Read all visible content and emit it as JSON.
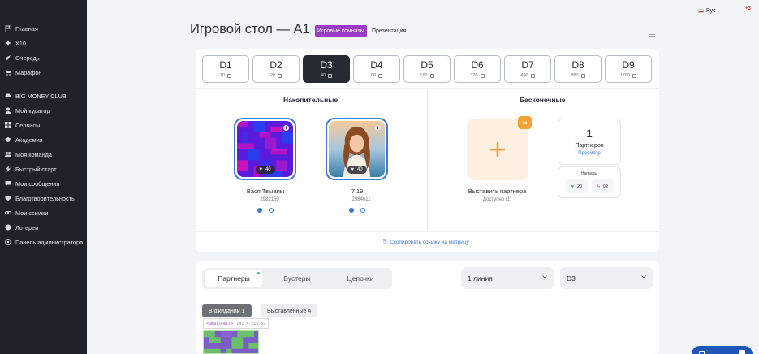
{
  "sidebar": {
    "items": [
      {
        "label": "Главная",
        "icon": "flag-icon"
      },
      {
        "label": "X10",
        "icon": "sparkle-icon"
      },
      {
        "label": "Очередь",
        "icon": "rocket-icon"
      },
      {
        "label": "Марафон",
        "icon": "cart-icon"
      }
    ],
    "items2": [
      {
        "label": "BIG MONEY CLUB",
        "icon": "car-icon"
      },
      {
        "label": "Мой куратор",
        "icon": "user-icon"
      },
      {
        "label": "Сервисы",
        "icon": "grid-icon"
      },
      {
        "label": "Академия",
        "icon": "graduation-cap-icon"
      },
      {
        "label": "Моя команда",
        "icon": "team-icon"
      },
      {
        "label": "Быстрый старт",
        "icon": "lightning-icon"
      },
      {
        "label": "Мои сообщения",
        "icon": "chat-icon"
      },
      {
        "label": "Благотворительность",
        "icon": "heart-icon"
      },
      {
        "label": "Мои ссылки",
        "icon": "link-icon"
      },
      {
        "label": "Лотереи",
        "icon": "ticket-icon"
      },
      {
        "label": "Панель администратора",
        "icon": "settings-icon"
      }
    ]
  },
  "topbar": {
    "lang": "Рус",
    "badge": "+3"
  },
  "page": {
    "title": "Игровой стол — A1",
    "tag_rooms": "Игровые комнаты",
    "tag_presentation": "Презентация"
  },
  "levels": [
    {
      "name": "D1",
      "value": "10"
    },
    {
      "name": "D2",
      "value": "20"
    },
    {
      "name": "D3",
      "value": "40",
      "active": true
    },
    {
      "name": "D4",
      "value": "80"
    },
    {
      "name": "D5",
      "value": "160"
    },
    {
      "name": "D6",
      "value": "320"
    },
    {
      "name": "D7",
      "value": "490"
    },
    {
      "name": "D8",
      "value": "880"
    },
    {
      "name": "D9",
      "value": "1760"
    }
  ],
  "accumulative": {
    "title": "Накопительные",
    "players": [
      {
        "name": "Вася Твыапы",
        "id": "2982159",
        "score": "40"
      },
      {
        "name": "7 19",
        "id": "2984611",
        "score": "40"
      }
    ]
  },
  "infinite": {
    "title": "Бесконечные",
    "add_title": "Выставить партнера",
    "add_sub": "Доступно (1)",
    "partners_count": "1",
    "partners_label": "Партнеров",
    "partners_link": "Просмотр",
    "rewards_label": "Награды",
    "reward_hearts": "20",
    "reward_bolts": "02"
  },
  "copy_link": "Скопировать ссылку на матрицу",
  "bottom": {
    "tabs": [
      "Партнеры",
      "Бустеры",
      "Цепочки"
    ],
    "select_line": "1 линия",
    "select_level": "D3",
    "sub_waiting": "В ожидании 1",
    "sub_placed": "Выставленные 4",
    "smallcell_tag": "<SmallCell>",
    "smallcell_dims": "142 × 215.59"
  }
}
